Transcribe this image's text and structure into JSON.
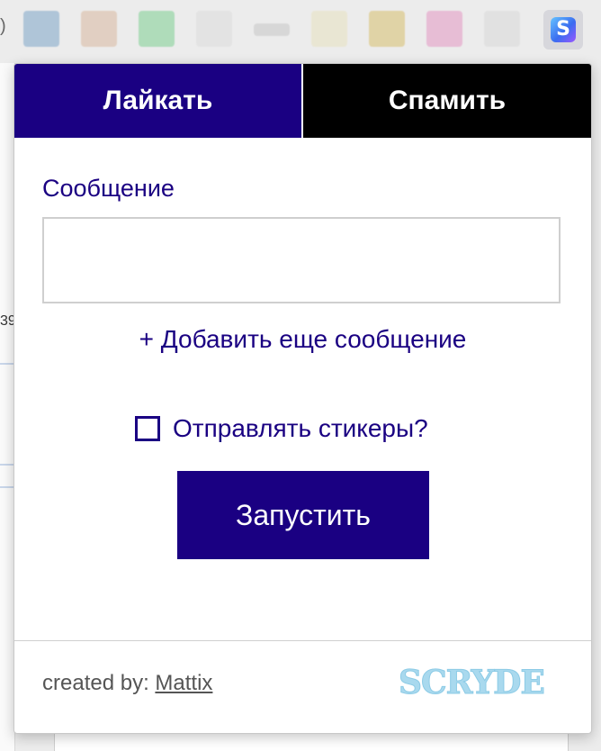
{
  "browser": {
    "scryde_extension_glyph": "S",
    "edge_glyph": ")"
  },
  "background": {
    "left_text": "39"
  },
  "tabs": [
    {
      "label": "Лайкать"
    },
    {
      "label": "Спамить"
    }
  ],
  "form": {
    "message_label": "Сообщение",
    "message_value": "",
    "add_more_label": "+ Добавить еще сообщение",
    "stickers_label": "Отправлять стикеры?",
    "stickers_checked": false,
    "run_label": "Запустить"
  },
  "footer": {
    "created_by_prefix": "created by:",
    "author": "Mattix",
    "logo_text": "SCRYDE"
  },
  "colors": {
    "accent": "#1a0082",
    "inactive_tab": "#000000",
    "logo": "#a9d9ee"
  }
}
